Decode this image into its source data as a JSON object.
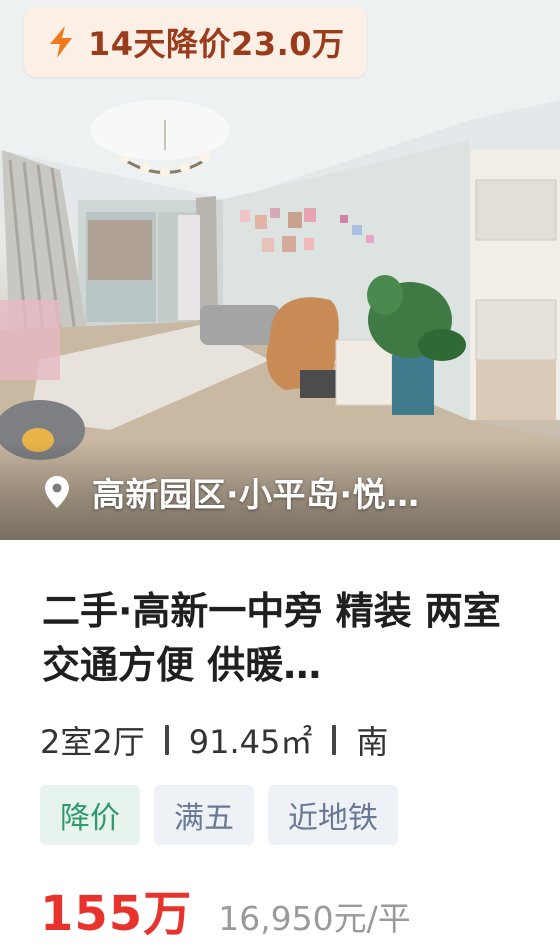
{
  "badge": {
    "icon": "lightning-icon",
    "text": "14天降价23.0万",
    "text_color": "#9a3c1c",
    "bg_color": "#fcefe6"
  },
  "location": {
    "icon": "location-pin-icon",
    "text": "高新园区·小平岛·悦…"
  },
  "listing": {
    "title": "二手·高新一中旁 精装 两室 交通方便 供暖…",
    "specs": {
      "layout": "2室2厅",
      "area": "91.45㎡",
      "orientation": "南"
    },
    "tags": [
      {
        "label": "降价",
        "style": "green"
      },
      {
        "label": "满五",
        "style": "gray"
      },
      {
        "label": "近地铁",
        "style": "gray"
      }
    ],
    "price": {
      "total": "155万",
      "unit": "16,950元/平",
      "accent_color": "#e8322c"
    }
  }
}
